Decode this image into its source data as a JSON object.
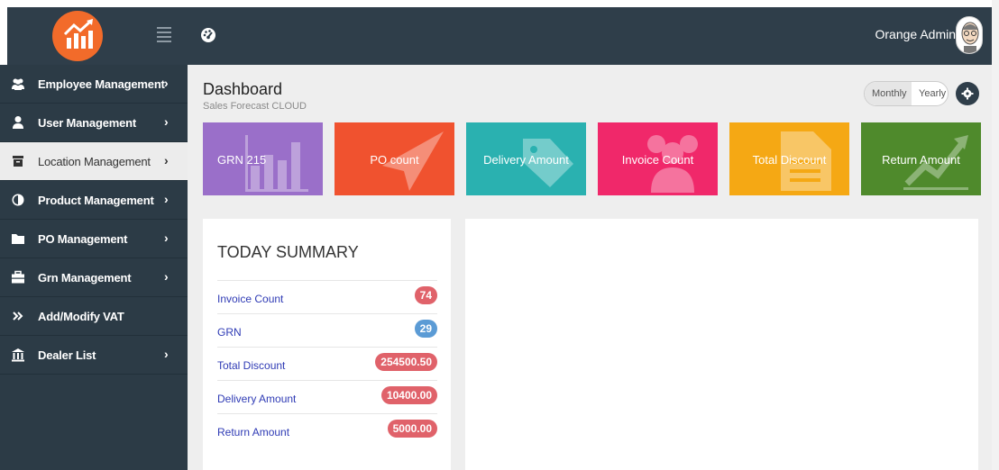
{
  "header": {
    "user_name": "Orange Admin",
    "icons": [
      "logo-icon",
      "menu-toggle-icon",
      "dashboard-icon",
      "avatar"
    ],
    "colors": {
      "header_bg": "#2f3e4a",
      "logo_bg": "#f26b2a"
    }
  },
  "sidebar": {
    "items": [
      {
        "label": "Employee Management",
        "icon": "users-icon",
        "chevron": "›",
        "active": false
      },
      {
        "label": "User Management",
        "icon": "user-icon",
        "chevron": "›",
        "active": false
      },
      {
        "label": "Location Management",
        "icon": "archive-icon",
        "chevron": "›",
        "active": true
      },
      {
        "label": "Product Management",
        "icon": "contrast-icon",
        "chevron": "›",
        "active": false
      },
      {
        "label": "PO Management",
        "icon": "folder-icon",
        "chevron": "›",
        "active": false
      },
      {
        "label": "Grn Management",
        "icon": "briefcase-icon",
        "chevron": "›",
        "active": false
      },
      {
        "label": "Add/Modify VAT",
        "icon": "double-chevron-icon",
        "chevron": "",
        "active": false
      },
      {
        "label": "Dealer List",
        "icon": "bank-icon",
        "chevron": "›",
        "active": false
      }
    ]
  },
  "page": {
    "title": "Dashboard",
    "subtitle": "Sales Forecast CLOUD",
    "range": {
      "monthly": "Monthly",
      "yearly": "Yearly",
      "selected": "Monthly"
    }
  },
  "tiles": [
    {
      "label": "GRN 215",
      "color": "#9a6fc9",
      "art": "bar-chart-icon"
    },
    {
      "label": "PO count",
      "color": "#f0522f",
      "art": "paper-plane-icon"
    },
    {
      "label": "Delivery Amount",
      "color": "#2ab1b0",
      "art": "tags-icon"
    },
    {
      "label": "Invoice Count",
      "color": "#f0286a",
      "art": "users-icon"
    },
    {
      "label": "Total Discount",
      "color": "#f5a814",
      "art": "document-icon"
    },
    {
      "label": "Return Amount",
      "color": "#4f8a2c",
      "art": "trend-chart-icon"
    }
  ],
  "summary": {
    "title": "TODAY SUMMARY",
    "rows": [
      {
        "label": "Invoice Count",
        "value": "74",
        "color": "#e0626a"
      },
      {
        "label": "GRN",
        "value": "29",
        "color": "#5b9bd5"
      },
      {
        "label": "Total Discount",
        "value": "254500.50",
        "color": "#e0626a"
      },
      {
        "label": "Delivery Amount",
        "value": "10400.00",
        "color": "#e0626a"
      },
      {
        "label": "Return Amount",
        "value": "5000.00",
        "color": "#e0626a"
      }
    ]
  }
}
